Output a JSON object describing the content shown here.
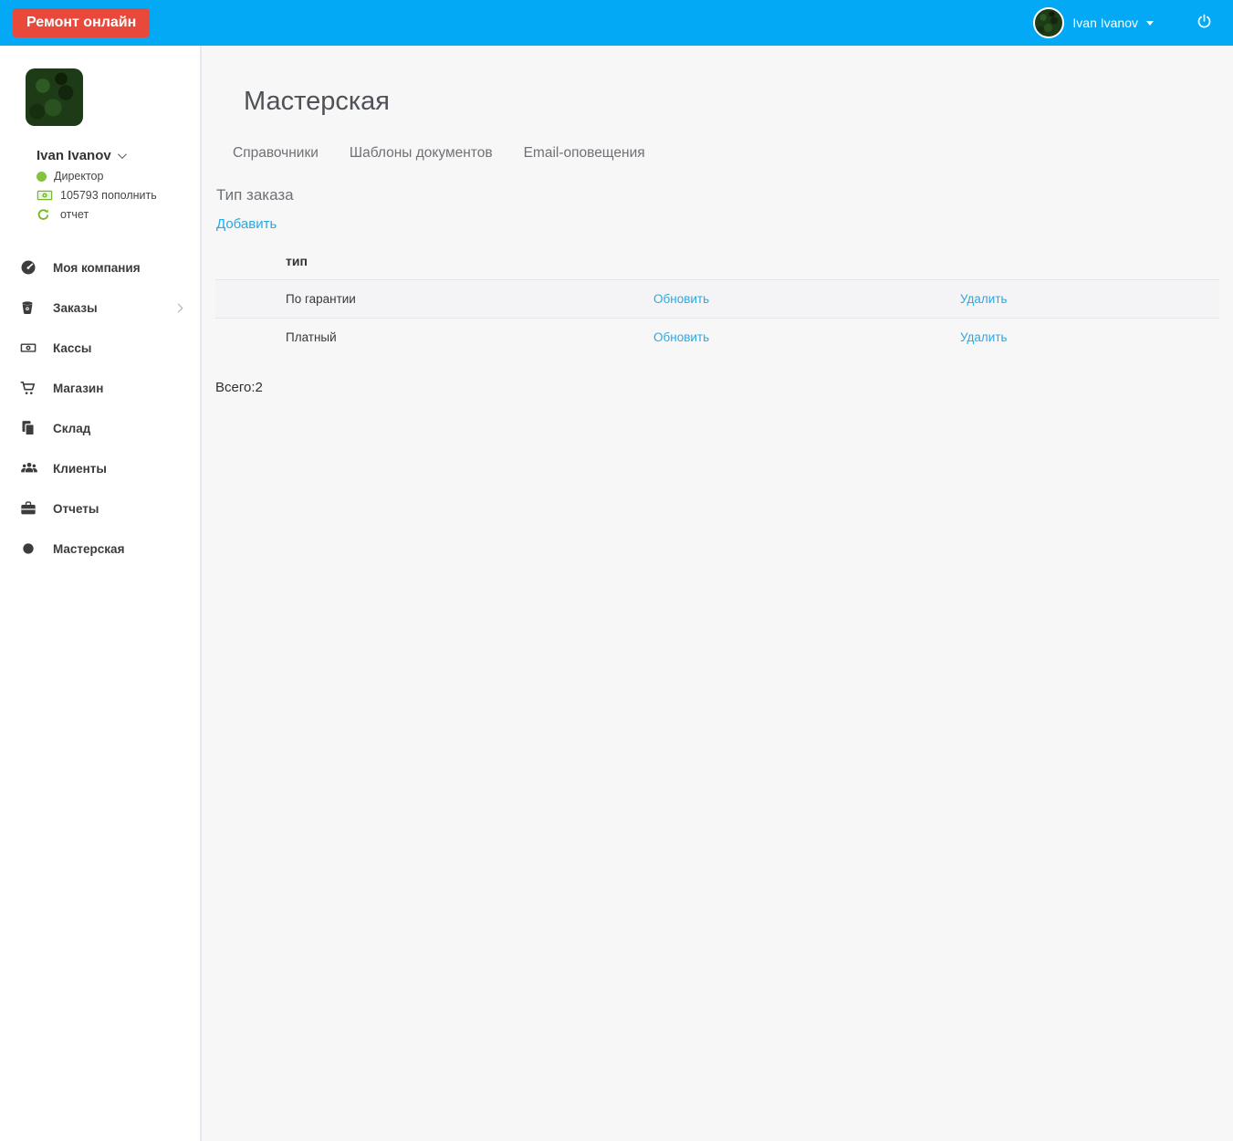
{
  "topbar": {
    "brand_label": "Ремонт онлайн",
    "user_name": "Ivan Ivanov"
  },
  "sidebar": {
    "user": {
      "name": "Ivan Ivanov",
      "role": "Директор",
      "balance": "105793 пополнить",
      "report": "отчет"
    },
    "items": [
      {
        "key": "my-company",
        "label": "Моя компания",
        "icon": "dashboard-icon",
        "has_submenu": false
      },
      {
        "key": "orders",
        "label": "Заказы",
        "icon": "bucket-icon",
        "has_submenu": true
      },
      {
        "key": "cash-registers",
        "label": "Кассы",
        "icon": "money-icon",
        "has_submenu": false
      },
      {
        "key": "shop",
        "label": "Магазин",
        "icon": "cart-icon",
        "has_submenu": false
      },
      {
        "key": "warehouse",
        "label": "Склад",
        "icon": "copy-icon",
        "has_submenu": false
      },
      {
        "key": "clients",
        "label": "Клиенты",
        "icon": "users-icon",
        "has_submenu": false
      },
      {
        "key": "reports",
        "label": "Отчеты",
        "icon": "briefcase-icon",
        "has_submenu": false
      },
      {
        "key": "workshop",
        "label": "Мастерская",
        "icon": "circle-icon",
        "has_submenu": false
      }
    ]
  },
  "main": {
    "title": "Мастерская",
    "tabs": [
      {
        "key": "directories",
        "label": "Справочники"
      },
      {
        "key": "document-templates",
        "label": "Шаблоны документов"
      },
      {
        "key": "email-notifications",
        "label": "Email-оповещения"
      }
    ],
    "section_title": "Тип заказа",
    "add_label": "Добавить",
    "table": {
      "header": "тип",
      "rows": [
        {
          "type": "По гарантии",
          "update_label": "Обновить",
          "delete_label": "Удалить"
        },
        {
          "type": "Платный",
          "update_label": "Обновить",
          "delete_label": "Удалить"
        }
      ]
    },
    "total": "Всего:2"
  },
  "colors": {
    "topbar_blue": "#03a9f4",
    "brand_red": "#e8493a",
    "link_blue": "#2aa9e0",
    "green": "#76b82a",
    "status_green": "#84c341"
  }
}
